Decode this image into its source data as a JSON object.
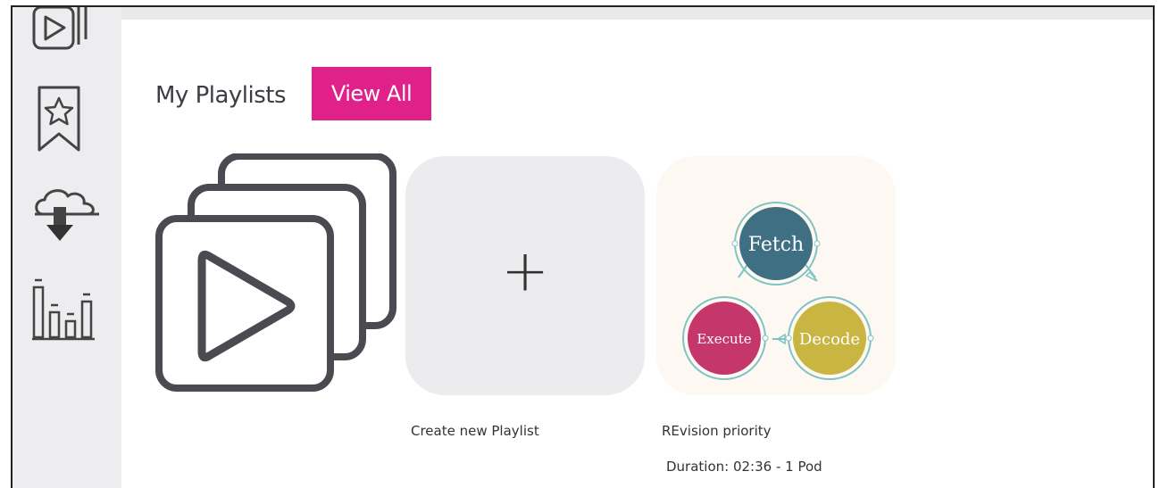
{
  "sidebar": {
    "items": [
      {
        "icon": "playlist-icon"
      },
      {
        "icon": "bookmark-star-icon"
      },
      {
        "icon": "cloud-download-icon"
      },
      {
        "icon": "bar-chart-icon"
      }
    ]
  },
  "playlists": {
    "heading": "My Playlists",
    "view_all_label": "View All",
    "create_label": "Create new Playlist",
    "create_symbol": "+",
    "items": [
      {
        "title": "REvision priority",
        "duration": "Duration: 02:36 - 1 Pod",
        "thumbnail_labels": {
          "top": "Fetch",
          "left": "Execute",
          "right": "Decode"
        }
      }
    ]
  },
  "colors": {
    "accent": "#e0218a",
    "fetch": "#3e6f83",
    "execute": "#c5366b",
    "decode": "#c9b542",
    "ring": "#7fc3c3"
  }
}
